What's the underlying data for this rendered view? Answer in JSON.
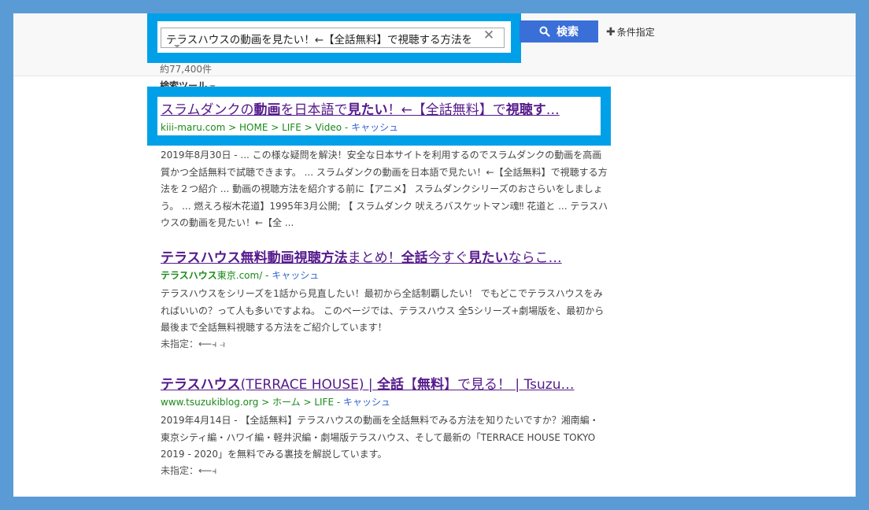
{
  "search": {
    "query": "テラスハウスの動画を見たい！←【全話無料】で視聴する方法を",
    "clear_symbol": "✕",
    "button_label": "検索",
    "advanced_label": "条件指定",
    "result_count": "約77,400件",
    "tools_label": "検索ツール"
  },
  "results": [
    {
      "title_parts": [
        "スラムダンクの",
        "動画",
        "を日本語で",
        "見たい",
        "！←【全話無料】で",
        "視聴す",
        "…"
      ],
      "url": "kiii-maru.com > HOME > LIFE > Video",
      "cache": "キャッシュ",
      "snippet": "2019年8月30日 - ... この様な疑問を解決！安全な日本サイトを利用するのでスラムダンクの動画を高画質かつ全話無料で試聴できます。 ... スラムダンクの動画を日本語で見たい！←【全話無料】で視聴する方法を２つ紹介 ... 動画の視聴方法を紹介する前に【アニメ】 スラムダンクシリーズのおさらいをしましょう。 ... 燃えろ桜木花道】1995年3月公開; 【 スラムダンク 吠えろバスケットマン魂‼ 花道と ... テラスハウスの動画を見たい！←【全 ..."
    },
    {
      "title_parts": [
        "テラスハウス無料動画視聴方法",
        "まとめ！",
        "全話",
        "今すぐ",
        "見たい",
        "ならこ…"
      ],
      "url_bold": "テラスハウス",
      "url": "東京.com/",
      "cache": "キャッシュ",
      "snippet": "テラスハウスをシリーズを1話から見直したい！最初から全話制覇したい！ でもどこでテラスハウスをみればいいの？って人も多いですよね。 このページでは、テラスハウス 全5シリーズ+劇場版を、最初から最後まで全話無料視聴する方法をご紹介しています！",
      "unspecified": "未指定：⟵⫞ ⥽"
    },
    {
      "title_parts": [
        "テラスハウス",
        "(TERRACE HOUSE) | ",
        "全話",
        "【",
        "無料",
        "】で見る！ | Tsuzu…"
      ],
      "url": "www.tsuzukiblog.org > ホーム > LIFE",
      "cache": "キャッシュ",
      "snippet": "2019年4月14日 - 【全話無料】テラスハウスの動画を全話無料でみる方法を知りたいですか？湘南編・ 東京シティ編・ハワイ編・軽井沢編・劇場版テラスハウス、そして最新の「TERRACE HOUSE TOKYO 2019 - 2020」を無料でみる裏技を解説しています。",
      "unspecified": "未指定：⟵⫞"
    }
  ]
}
